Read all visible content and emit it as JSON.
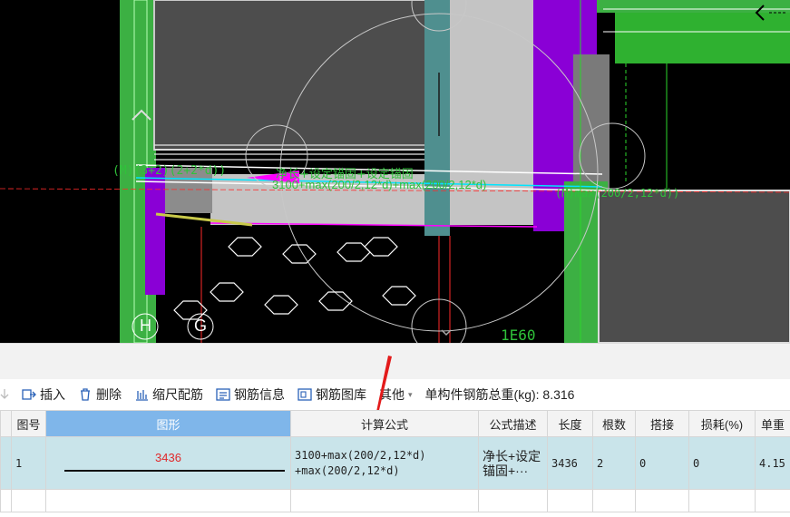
{
  "cad": {
    "left_label": "(M)(3+2)(2+2*d))",
    "formula_desc": "净长+设定锚固+设定锚固",
    "formula_expr": "3100+max(200/2,12*d)+max(200/2,12*d)",
    "right_label": "(M)max(200/2,12*d))",
    "axis_h": "H",
    "axis_g": "G",
    "bottom_text": "1E60",
    "colors": {
      "green": "#3cb043",
      "purple": "#8a00d6",
      "gray": "#8c8c8c",
      "cyan": "#00e5ff",
      "magenta": "#ff00ff"
    }
  },
  "toolbar": {
    "insert": "插入",
    "delete": "删除",
    "scale": "缩尺配筋",
    "info": "钢筋信息",
    "library": "钢筋图库",
    "other": "其他",
    "total_weight": "单构件钢筋总重(kg): 8.316"
  },
  "table": {
    "headers": [
      "图号",
      "图形",
      "计算公式",
      "公式描述",
      "长度",
      "根数",
      "搭接",
      "损耗(%)",
      "单重"
    ],
    "row": {
      "figure_no": "1",
      "shape_value": "3436",
      "formula_line1": "3100+max(200/2,12*d)",
      "formula_line2": "+max(200/2,12*d)",
      "description_line1": "净长+设定",
      "description_line2": "锚固+···",
      "length": "3436",
      "count": "2",
      "lap": "0",
      "loss": "0",
      "unit_weight": "4.15"
    }
  }
}
